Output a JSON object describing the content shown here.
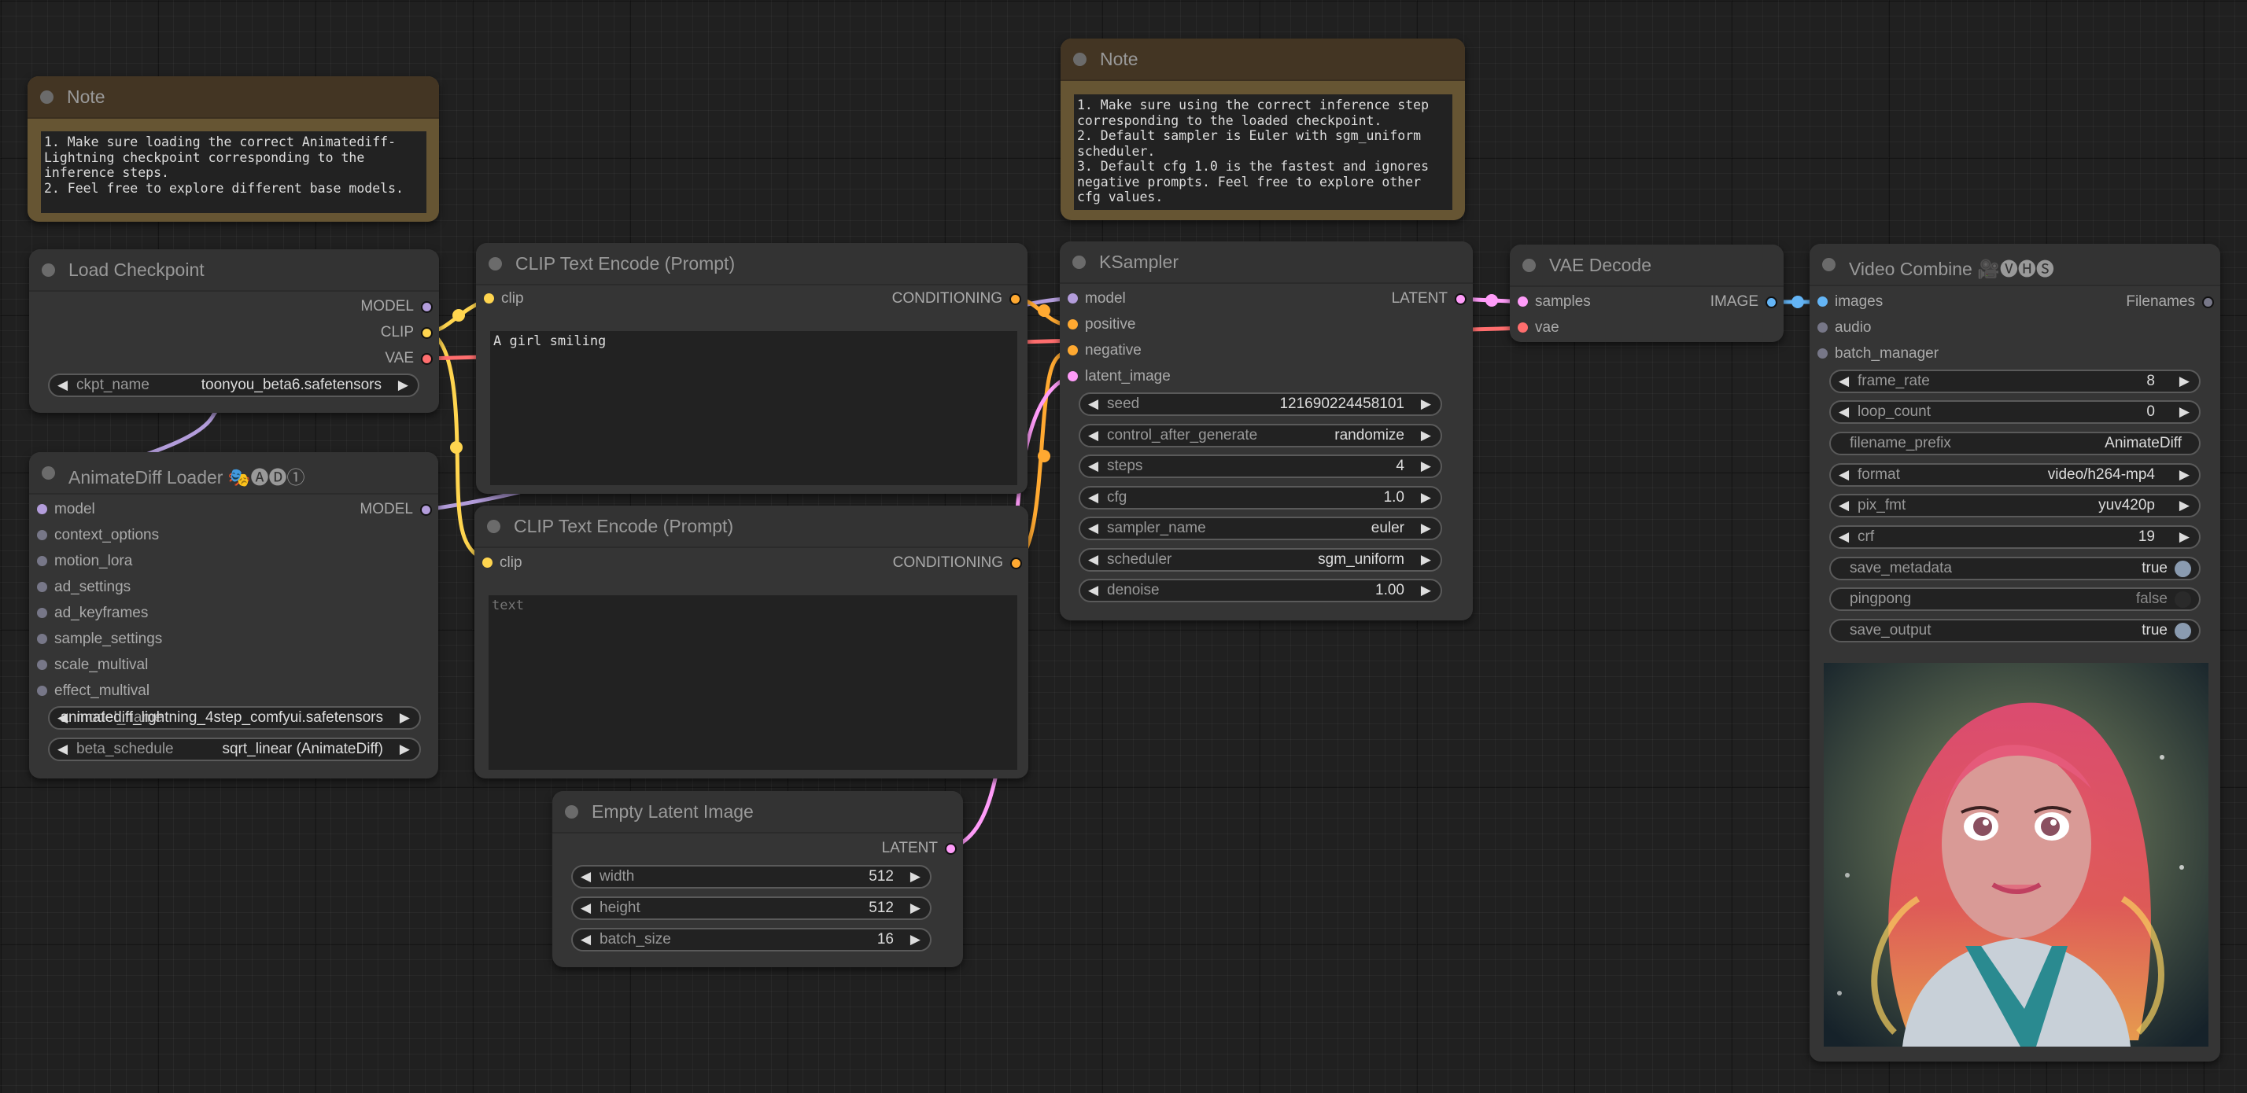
{
  "colors": {
    "model": "#b39ddb",
    "clip": "#ffd54f",
    "vae": "#ff6e6e",
    "conditioning": "#ffa931",
    "latent": "#ff9cf9",
    "image": "#64b5f6",
    "generic": "#778"
  },
  "note1": {
    "title": "Note",
    "text": "1. Make sure loading the correct Animatediff-Lightning checkpoint corresponding to the inference steps.\n2. Feel free to explore different base models."
  },
  "note2": {
    "title": "Note",
    "text": "1. Make sure using the correct inference step corresponding to the loaded checkpoint.\n2. Default sampler is Euler with sgm_uniform scheduler.\n3. Default cfg 1.0 is the fastest and ignores negative prompts. Feel free to explore other cfg values."
  },
  "load_checkpoint": {
    "title": "Load Checkpoint",
    "outputs": [
      "MODEL",
      "CLIP",
      "VAE"
    ],
    "ckpt_name": {
      "label": "ckpt_name",
      "value": "toonyou_beta6.safetensors"
    }
  },
  "animatediff_loader": {
    "title": "AnimateDiff Loader 🎭🅐🅓①",
    "inputs": [
      "model",
      "context_options",
      "motion_lora",
      "ad_settings",
      "ad_keyframes",
      "sample_settings",
      "scale_multival",
      "effect_multival"
    ],
    "output": "MODEL",
    "model_name": {
      "label": "model_name",
      "value": "animatediff_lightning_4step_comfyui.safetensors"
    },
    "beta_schedule": {
      "label": "beta_schedule",
      "value": "sqrt_linear (AnimateDiff)"
    }
  },
  "clip_positive": {
    "title": "CLIP Text Encode (Prompt)",
    "input": "clip",
    "output": "CONDITIONING",
    "text": "A girl smiling",
    "placeholder": "text"
  },
  "clip_negative": {
    "title": "CLIP Text Encode (Prompt)",
    "input": "clip",
    "output": "CONDITIONING",
    "text": "",
    "placeholder": "text"
  },
  "empty_latent": {
    "title": "Empty Latent Image",
    "output": "LATENT",
    "widgets": [
      {
        "label": "width",
        "value": "512"
      },
      {
        "label": "height",
        "value": "512"
      },
      {
        "label": "batch_size",
        "value": "16"
      }
    ]
  },
  "ksampler": {
    "title": "KSampler",
    "inputs": [
      "model",
      "positive",
      "negative",
      "latent_image"
    ],
    "output": "LATENT",
    "widgets": [
      {
        "label": "seed",
        "value": "121690224458101"
      },
      {
        "label": "control_after_generate",
        "value": "randomize"
      },
      {
        "label": "steps",
        "value": "4"
      },
      {
        "label": "cfg",
        "value": "1.0"
      },
      {
        "label": "sampler_name",
        "value": "euler"
      },
      {
        "label": "scheduler",
        "value": "sgm_uniform"
      },
      {
        "label": "denoise",
        "value": "1.00"
      }
    ]
  },
  "vae_decode": {
    "title": "VAE Decode",
    "inputs": [
      "samples",
      "vae"
    ],
    "output": "IMAGE"
  },
  "video_combine": {
    "title": "Video Combine 🎥🅥🅗🅢",
    "inputs": [
      "images",
      "audio",
      "batch_manager"
    ],
    "output": "Filenames",
    "widgets": [
      {
        "label": "frame_rate",
        "value": "8"
      },
      {
        "label": "loop_count",
        "value": "0"
      },
      {
        "label": "filename_prefix",
        "value": "AnimateDiff"
      },
      {
        "label": "format",
        "value": "video/h264-mp4"
      },
      {
        "label": "pix_fmt",
        "value": "yuv420p"
      },
      {
        "label": "crf",
        "value": "19"
      },
      {
        "label": "save_metadata",
        "value": "true"
      },
      {
        "label": "pingpong",
        "value": "false"
      },
      {
        "label": "save_output",
        "value": "true"
      }
    ],
    "preview_alt": "Animated preview: smiling girl with pink-red hair"
  },
  "icons": {
    "arrow_left": "◀",
    "arrow_right": "▶"
  }
}
